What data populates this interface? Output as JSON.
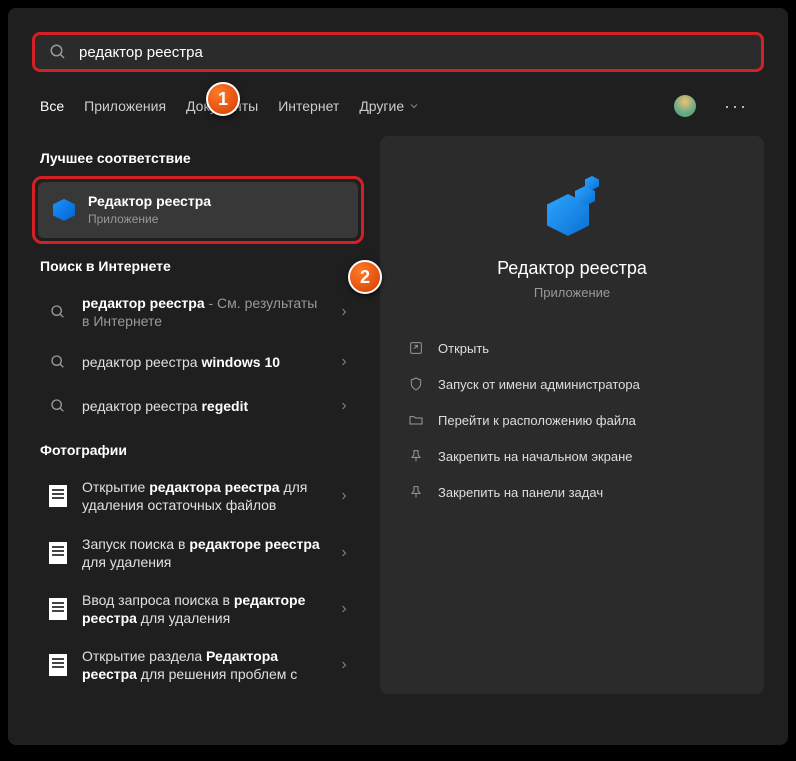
{
  "search": {
    "value": "редактор реестра"
  },
  "tabs": {
    "all": "Все",
    "apps": "Приложения",
    "docs": "Документы",
    "web": "Интернет",
    "more": "Другие"
  },
  "sections": {
    "best_match": "Лучшее соответствие",
    "web_search": "Поиск в Интернете",
    "photos": "Фотографии"
  },
  "best_match": {
    "title": "Редактор реестра",
    "subtitle": "Приложение"
  },
  "web_results": [
    {
      "prefix": "редактор реестра",
      "suffix": " - См. результаты в Интернете"
    },
    {
      "prefix": "редактор реестра ",
      "bold": "windows 10"
    },
    {
      "prefix": "редактор реестра ",
      "bold": "regedit"
    }
  ],
  "photo_results": [
    {
      "p1": "Открытие ",
      "b1": "редактора реестра",
      "p2": " для удаления остаточных файлов"
    },
    {
      "p1": "Запуск поиска в ",
      "b1": "редакторе реестра",
      "p2": " для удаления"
    },
    {
      "p1": "Ввод запроса поиска в ",
      "b1": "редакторе реестра",
      "p2": " для удаления"
    },
    {
      "p1": "Открытие раздела ",
      "b1": "Редактора реестра",
      "p2": " для решения проблем с"
    }
  ],
  "details": {
    "title": "Редактор реестра",
    "type": "Приложение",
    "actions": {
      "open": "Открыть",
      "admin": "Запуск от имени администратора",
      "location": "Перейти к расположению файла",
      "pin_start": "Закрепить на начальном экране",
      "pin_taskbar": "Закрепить на панели задач"
    }
  },
  "badges": {
    "one": "1",
    "two": "2"
  }
}
